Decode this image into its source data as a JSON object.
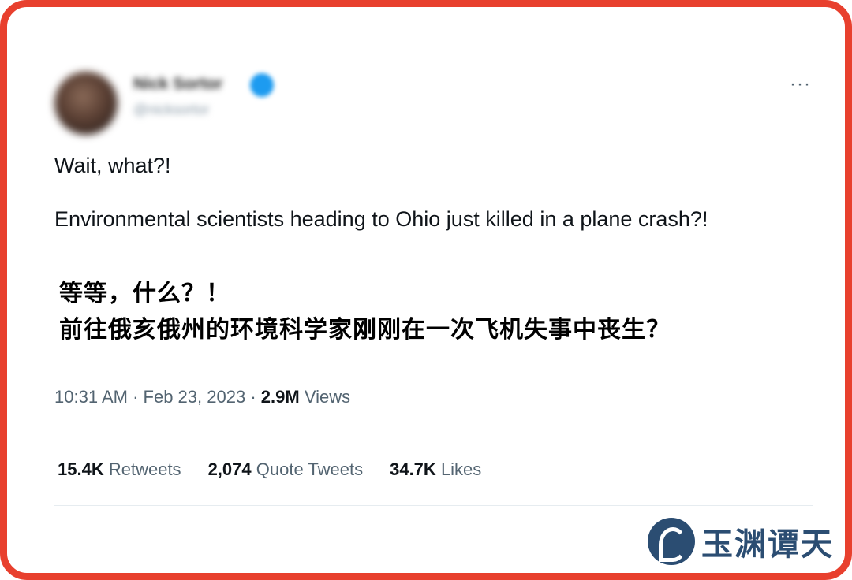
{
  "tweet": {
    "author_name": "Nick Sortor",
    "author_handle": "@nicksortor",
    "text_line1": "Wait, what?!",
    "text_line2": "Environmental scientists heading to Ohio just killed in a plane crash?!",
    "time": "10:31 AM",
    "date": "Feb 23, 2023",
    "views_count": "2.9M",
    "views_label": "Views",
    "retweets_count": "15.4K",
    "retweets_label": "Retweets",
    "quotes_count": "2,074",
    "quotes_label": "Quote Tweets",
    "likes_count": "34.7K",
    "likes_label": "Likes",
    "more_icon": "···"
  },
  "caption": {
    "line1": "等等，什么？！",
    "line2": "前往俄亥俄州的环境科学家刚刚在一次飞机失事中丧生？"
  },
  "watermark": {
    "text": "玉渊谭天"
  },
  "colors": {
    "frame": "#e8402e",
    "verified": "#1d9bf0",
    "brand": "#2b4d72"
  }
}
